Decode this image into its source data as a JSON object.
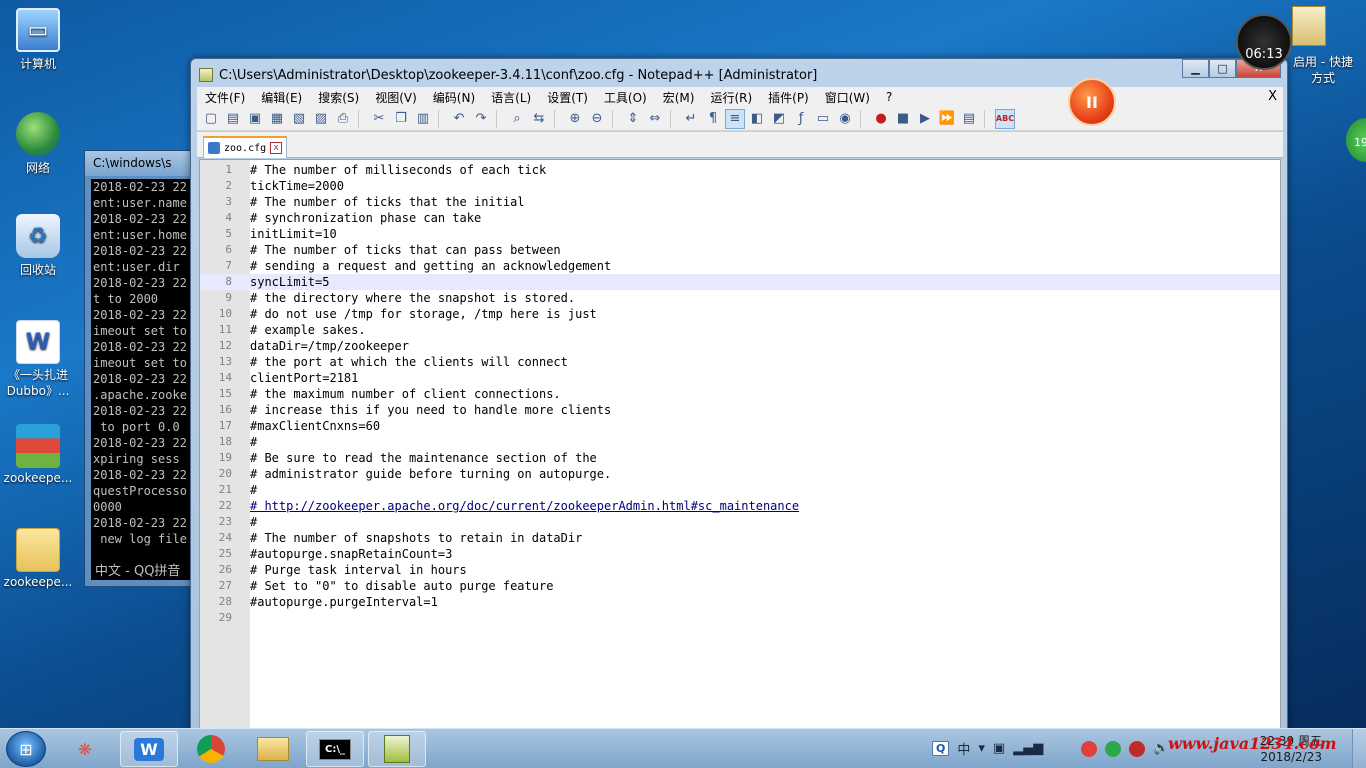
{
  "desktop": {
    "icons": [
      {
        "label": "计算机"
      },
      {
        "label": "网络"
      },
      {
        "label": "回收站"
      },
      {
        "label": "《一头扎进Dubbo》..."
      },
      {
        "label": "zookeepe..."
      },
      {
        "label": "zookeepe..."
      }
    ],
    "shortcut_label": "启用 - 快捷方式"
  },
  "console": {
    "title": "C:\\windows\\s",
    "lines": "2018-02-23 22\nent:user.name\n2018-02-23 22\nent:user.home\n2018-02-23 22\nent:user.dir\n2018-02-23 22\nt to 2000\n2018-02-23 22\nimeout set to\n2018-02-23 22\nimeout set to\n2018-02-23 22\n.apache.zooke\n2018-02-23 22\n to port 0.0\n2018-02-23 22\nxpiring sess\n2018-02-23 22\nquestProcesso\n0000\n2018-02-23 22\n new log file",
    "status": "中文 - QQ拼音"
  },
  "window": {
    "title": "C:\\Users\\Administrator\\Desktop\\zookeeper-3.4.11\\conf\\zoo.cfg - Notepad++ [Administrator]",
    "minimize": "▁",
    "maximize": "□",
    "close": "✕"
  },
  "menu": {
    "items": [
      "文件(F)",
      "编辑(E)",
      "搜索(S)",
      "视图(V)",
      "编码(N)",
      "语言(L)",
      "设置(T)",
      "工具(O)",
      "宏(M)",
      "运行(R)",
      "插件(P)",
      "窗口(W)",
      "?"
    ],
    "close_doc": "X"
  },
  "tab": {
    "label": "zoo.cfg",
    "close": "x"
  },
  "editor": {
    "current_line": 8,
    "lines": [
      "# The number of milliseconds of each tick",
      "tickTime=2000",
      "# The number of ticks that the initial",
      "# synchronization phase can take",
      "initLimit=10",
      "# The number of ticks that can pass between",
      "# sending a request and getting an acknowledgement",
      "syncLimit=5",
      "# the directory where the snapshot is stored.",
      "# do not use /tmp for storage, /tmp here is just",
      "# example sakes.",
      "dataDir=/tmp/zookeeper",
      "# the port at which the clients will connect",
      "clientPort=2181",
      "# the maximum number of client connections.",
      "# increase this if you need to handle more clients",
      "#maxClientCnxns=60",
      "#",
      "# Be sure to read the maintenance section of the",
      "# administrator guide before turning on autopurge.",
      "#",
      "# http://zookeeper.apache.org/doc/current/zookeeperAdmin.html#sc_maintenance",
      "#",
      "# The number of snapshots to retain in dataDir",
      "#autopurge.snapRetainCount=3",
      "# Purge task interval in hours",
      "# Set to \"0\" to disable auto purge feature",
      "#autopurge.purgeInterval=1",
      ""
    ]
  },
  "widgets": {
    "recorder_time": "06:13",
    "recorder_pause": "II",
    "badge": "19"
  },
  "taskbar": {
    "tray_ime": "Q",
    "tray_lang": "中",
    "clock_time": "22:39 周五",
    "clock_date": "2018/2/23",
    "watermark": "www.java1234.com"
  }
}
